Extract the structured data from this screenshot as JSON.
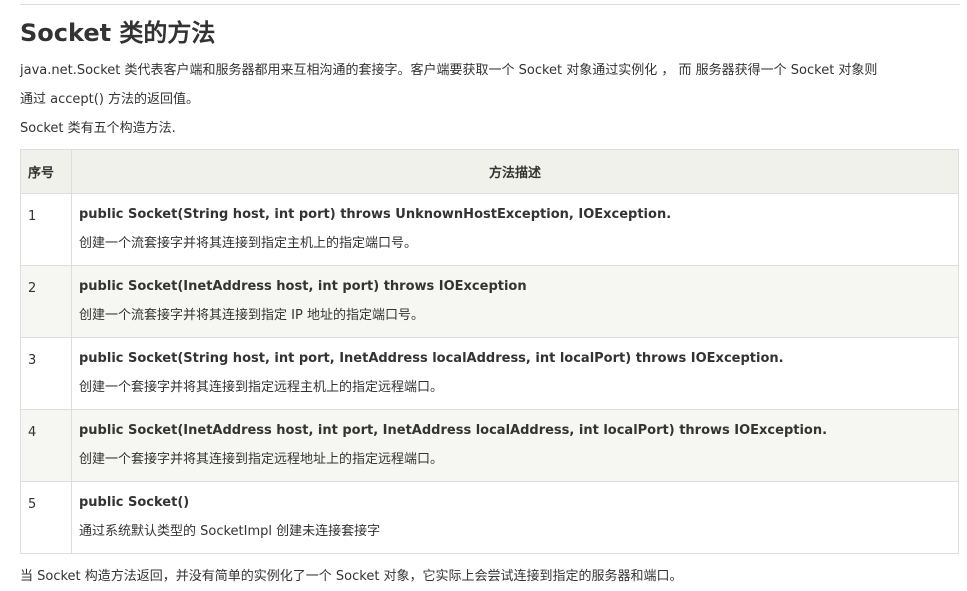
{
  "title": "Socket 类的方法",
  "intro": {
    "line1": "java.net.Socket 类代表客户端和服务器都用来互相沟通的套接字。客户端要获取一个 Socket 对象通过实例化 ， 而 服务器获得一个 Socket 对象则",
    "line2": "通过 accept() 方法的返回值。",
    "line3": "Socket 类有五个构造方法."
  },
  "table": {
    "headers": {
      "num": "序号",
      "desc": "方法描述"
    },
    "rows": [
      {
        "num": "1",
        "signature": "public Socket(String host, int port) throws UnknownHostException, IOException.",
        "description": "创建一个流套接字并将其连接到指定主机上的指定端口号。"
      },
      {
        "num": "2",
        "signature": "public Socket(InetAddress host, int port) throws IOException",
        "description": "创建一个流套接字并将其连接到指定 IP 地址的指定端口号。"
      },
      {
        "num": "3",
        "signature": "public Socket(String host, int port, InetAddress localAddress, int localPort) throws IOException.",
        "description": "创建一个套接字并将其连接到指定远程主机上的指定远程端口。"
      },
      {
        "num": "4",
        "signature": "public Socket(InetAddress host, int port, InetAddress localAddress, int localPort) throws IOException.",
        "description": "创建一个套接字并将其连接到指定远程地址上的指定远程端口。"
      },
      {
        "num": "5",
        "signature": "public Socket()",
        "description": "通过系统默认类型的 SocketImpl 创建未连接套接字"
      }
    ]
  },
  "after": "当 Socket 构造方法返回，并没有简单的实例化了一个 Socket 对象，它实际上会尝试连接到指定的服务器和端口。",
  "colors": {
    "header_bg": "#f1f1ec",
    "shaded_row_bg": "#f6f6f2",
    "border": "#dddddd",
    "text": "#333333"
  }
}
